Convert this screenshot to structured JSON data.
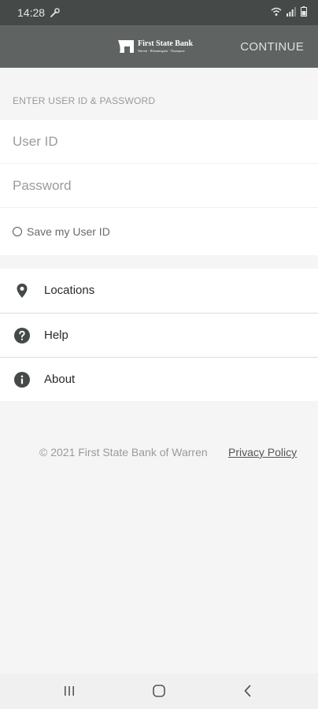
{
  "status_bar": {
    "time": "14:28",
    "icons": [
      "wrench-icon",
      "wifi-icon",
      "signal-icon",
      "battery-icon"
    ]
  },
  "header": {
    "logo_name": "First State Bank",
    "logo_tagline": "Warren · Bloomington · Thompson",
    "continue_label": "CONTINUE"
  },
  "login": {
    "section_label": "ENTER USER ID & PASSWORD",
    "user_id_placeholder": "User ID",
    "password_placeholder": "Password",
    "save_user_label": "Save my User ID"
  },
  "menu": {
    "items": [
      {
        "label": "Locations",
        "icon": "location-pin-icon"
      },
      {
        "label": "Help",
        "icon": "help-icon"
      },
      {
        "label": "About",
        "icon": "info-icon"
      }
    ]
  },
  "footer": {
    "copyright": "© 2021 First State Bank of Warren",
    "privacy_label": "Privacy Policy"
  },
  "nav": {
    "buttons": [
      "recent-apps-icon",
      "home-icon",
      "back-icon"
    ]
  },
  "colors": {
    "status_bar_bg": "#454a49",
    "app_bar_bg": "#5f6462",
    "page_bg": "#f5f5f5",
    "icon_fill": "#454a49"
  }
}
